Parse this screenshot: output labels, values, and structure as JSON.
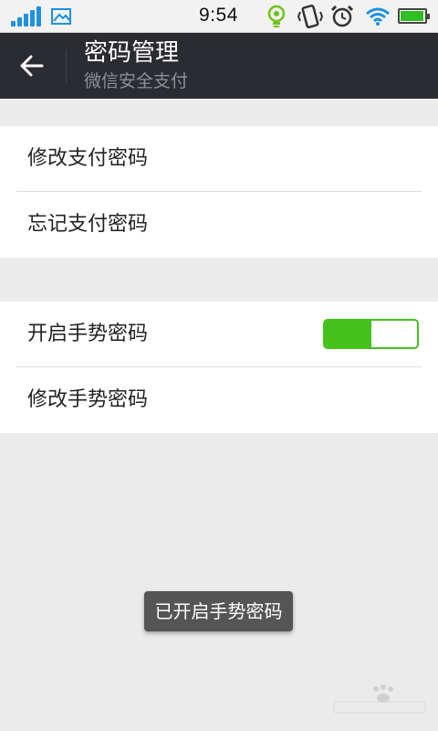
{
  "status_bar": {
    "time": "9:54",
    "icons": [
      "signal-icon",
      "gallery-icon",
      "bulb-icon",
      "vibrate-icon",
      "alarm-icon",
      "wifi-icon",
      "battery-icon"
    ],
    "accent": "#1e90e0",
    "battery_level": 0.95
  },
  "header": {
    "title": "密码管理",
    "subtitle": "微信安全支付",
    "background": "#2a2c31"
  },
  "payment_group": {
    "items": [
      {
        "label": "修改支付密码"
      },
      {
        "label": "忘记支付密码"
      }
    ]
  },
  "gesture_group": {
    "items": [
      {
        "label": "开启手势密码",
        "toggle_on": true
      },
      {
        "label": "修改手势密码"
      }
    ],
    "toggle_color": "#46c01d"
  },
  "toast": {
    "message": "已开启手势密码"
  },
  "watermark": {
    "icons": [
      "baidu-paw-icon"
    ]
  }
}
